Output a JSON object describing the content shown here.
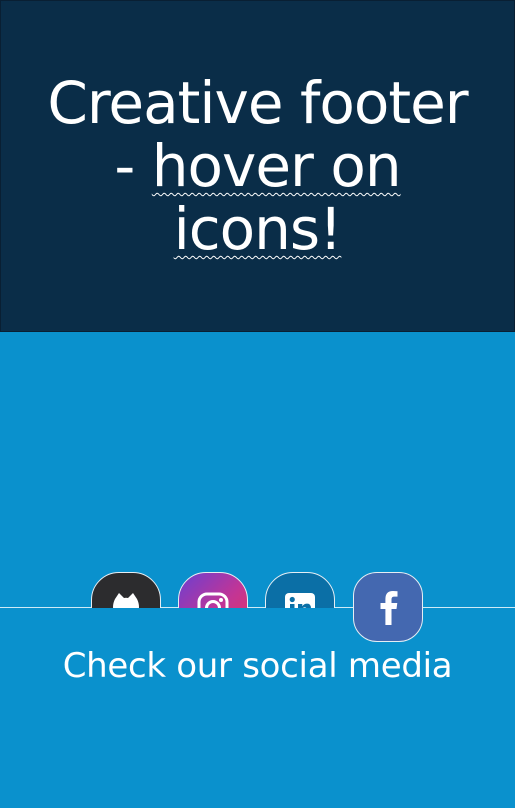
{
  "hero": {
    "title_line1": "Creative footer",
    "title_dash": "- ",
    "title_link1": "hover on",
    "title_link2": "icons!",
    "background_color": "#0a2d48"
  },
  "footer": {
    "background_color": "#0a91cd",
    "caption": "Check our social media",
    "social_links": [
      {
        "name": "GitHub",
        "icon": "github-icon",
        "color": "#2c2c2e"
      },
      {
        "name": "Instagram",
        "icon": "instagram-icon",
        "color": "#c13596"
      },
      {
        "name": "LinkedIn",
        "icon": "linkedin-icon",
        "color": "#0b6fa6"
      },
      {
        "name": "Facebook",
        "icon": "facebook-icon",
        "color": "#4468b0"
      }
    ]
  }
}
